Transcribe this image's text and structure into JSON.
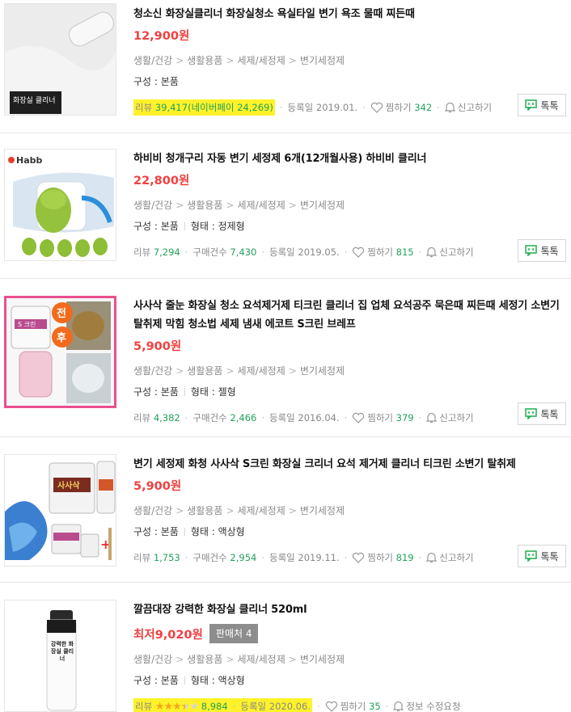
{
  "items": [
    {
      "title": "청소신 화장실클리너 화장실청소 욕실타일 변기 욕조 물때 찌든때",
      "price": "12,900원",
      "category": [
        "생활/건강",
        "생활용품",
        "세제/세정제",
        "변기세정제"
      ],
      "spec": [
        "구성 : 본품"
      ],
      "review_label": "리뷰",
      "review_count": "39,417",
      "review_extra": "(네이버페이 24,269)",
      "registered": "등록일 2019.01.",
      "wish_label": "찜하기",
      "wish_count": "342",
      "report_label": "신고하기",
      "talk_label": "톡톡",
      "thumb_text": "화장실 클리너"
    },
    {
      "title": "하비비 청개구리 자동 변기 세정제 6개(12개월사용) 하비비 클리너",
      "price": "22,800원",
      "category": [
        "생활/건강",
        "생활용품",
        "세제/세정제",
        "변기세정제"
      ],
      "spec": [
        "구성 : 본품",
        "형태 : 정제형"
      ],
      "review_label": "리뷰",
      "review_count": "7,294",
      "purchase_label": "구매건수",
      "purchase_count": "7,430",
      "registered": "등록일 2019.05.",
      "wish_label": "찜하기",
      "wish_count": "815",
      "report_label": "신고하기",
      "talk_label": "톡톡",
      "thumb_text": "Habb"
    },
    {
      "title": "사사삭 줄눈 화장실 청소 요석제거제 티크린 클리너 집 업체 요석공주 묵은때 찌든때 세정기 소변기 탈취제 막힘 청소법 세제 냄새 에코트 S크린 브레프",
      "price": "5,900원",
      "category": [
        "생활/건강",
        "생활용품",
        "세제/세정제",
        "변기세정제"
      ],
      "spec": [
        "구성 : 본품",
        "형태 : 젤형"
      ],
      "review_label": "리뷰",
      "review_count": "4,382",
      "purchase_label": "구매건수",
      "purchase_count": "2,466",
      "registered": "등록일 2016.04.",
      "wish_label": "찜하기",
      "wish_count": "379",
      "report_label": "신고하기",
      "talk_label": "톡톡",
      "thumb_before": "전",
      "thumb_after": "후",
      "thumb_text": "S 크린"
    },
    {
      "title": "변기 세정제 화청 사사삭 S크린 화장실 크리너 요석 제거제 클리너 티크린 소변기 탈취제",
      "price": "5,900원",
      "category": [
        "생활/건강",
        "생활용품",
        "세제/세정제",
        "변기세정제"
      ],
      "spec": [
        "구성 : 본품",
        "형태 : 액상형"
      ],
      "review_label": "리뷰",
      "review_count": "1,753",
      "purchase_label": "구매건수",
      "purchase_count": "2,954",
      "registered": "등록일 2019.11.",
      "wish_label": "찜하기",
      "wish_count": "819",
      "report_label": "신고하기",
      "talk_label": "톡톡",
      "thumb_text": "사사삭"
    },
    {
      "title": "깔끔대장 강력한 화장실 클리너 520ml",
      "price_prefix": "최저",
      "price": "9,020원",
      "seller_badge": "판매처 4",
      "category": [
        "생활/건강",
        "생활용품",
        "세제/세정제",
        "변기세정제"
      ],
      "spec": [
        "구성 : 본품",
        "형태 : 액상형"
      ],
      "review_label": "리뷰",
      "rating": 3.5,
      "review_count": "8,984",
      "registered": "등록일 2020.06.",
      "wish_label": "찜하기",
      "wish_count": "35",
      "report_label": "정보 수정요청",
      "thumb_text": "강력한 화장실 클리너"
    }
  ],
  "colors": {
    "price": "#f04040",
    "count": "#22a15a",
    "highlight": "#fff22a",
    "talk_icon": "#1fae4f",
    "star": "#f4a81c"
  }
}
